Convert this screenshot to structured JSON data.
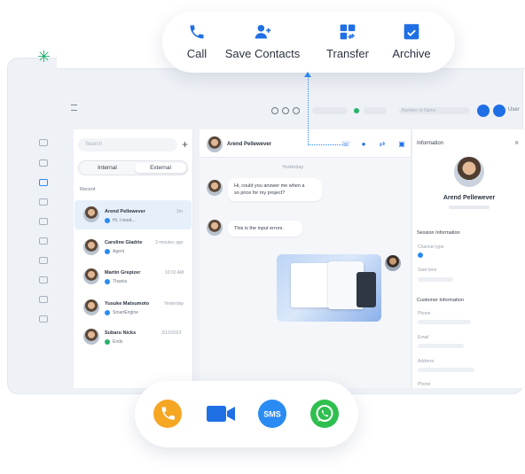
{
  "top_actions": {
    "items": [
      {
        "label": "Call",
        "icon": "phone-icon"
      },
      {
        "label": "Save Contacts",
        "icon": "add-contact-icon"
      },
      {
        "label": "Transfer",
        "icon": "transfer-icon"
      },
      {
        "label": "Archive",
        "icon": "archive-icon"
      }
    ]
  },
  "colors": {
    "brand_blue": "#1f6fe5",
    "accent_blue": "#2a8bf2",
    "call_orange": "#f5a623",
    "video_blue": "#1f6fe5",
    "sms_blue": "#2a8bf2",
    "whatsapp_green": "#2fbf4f"
  },
  "list": {
    "search_placeholder": "Search",
    "tabs": [
      "Internal",
      "External"
    ],
    "section_label": "Recent",
    "conversations": [
      {
        "name": "Arend Pellewever",
        "time": "2m",
        "sub": "Hi, I need..."
      },
      {
        "name": "Caroline Gladrie",
        "time": "3 minutes ago",
        "sub": "Agent"
      },
      {
        "name": "Martin Grepizer",
        "time": "10:02 AM",
        "sub": "Thanks"
      },
      {
        "name": "Yusuke Matsumoto",
        "time": "Yesterday",
        "sub": "SmartEngine"
      },
      {
        "name": "Subaru Nicks",
        "time": "3/12/2023",
        "sub": "Ends"
      }
    ]
  },
  "chat": {
    "contact_name": "Arend Pellewever",
    "day_label": "Yesterday",
    "messages": [
      "Hi, could you answer me when a\nso price for my project?",
      "This is the input errors."
    ]
  },
  "info": {
    "title": "Information",
    "name": "Arend Pellewever",
    "section_session": "Session Information",
    "field_channel": "Channel type",
    "field_start": "Start time",
    "section_customer": "Customer Information",
    "field_phone": "Phone",
    "field_email": "Email",
    "field_address": "Address",
    "field_more": "Phone"
  },
  "topbar": {
    "search_placeholder": "Number or Name",
    "user_label": "User"
  },
  "bottom_channels": [
    {
      "name": "call",
      "icon": "phone-icon"
    },
    {
      "name": "video",
      "icon": "video-camera-icon"
    },
    {
      "name": "sms",
      "icon": "sms-icon",
      "text": "SMS"
    },
    {
      "name": "whatsapp",
      "icon": "whatsapp-icon"
    }
  ]
}
